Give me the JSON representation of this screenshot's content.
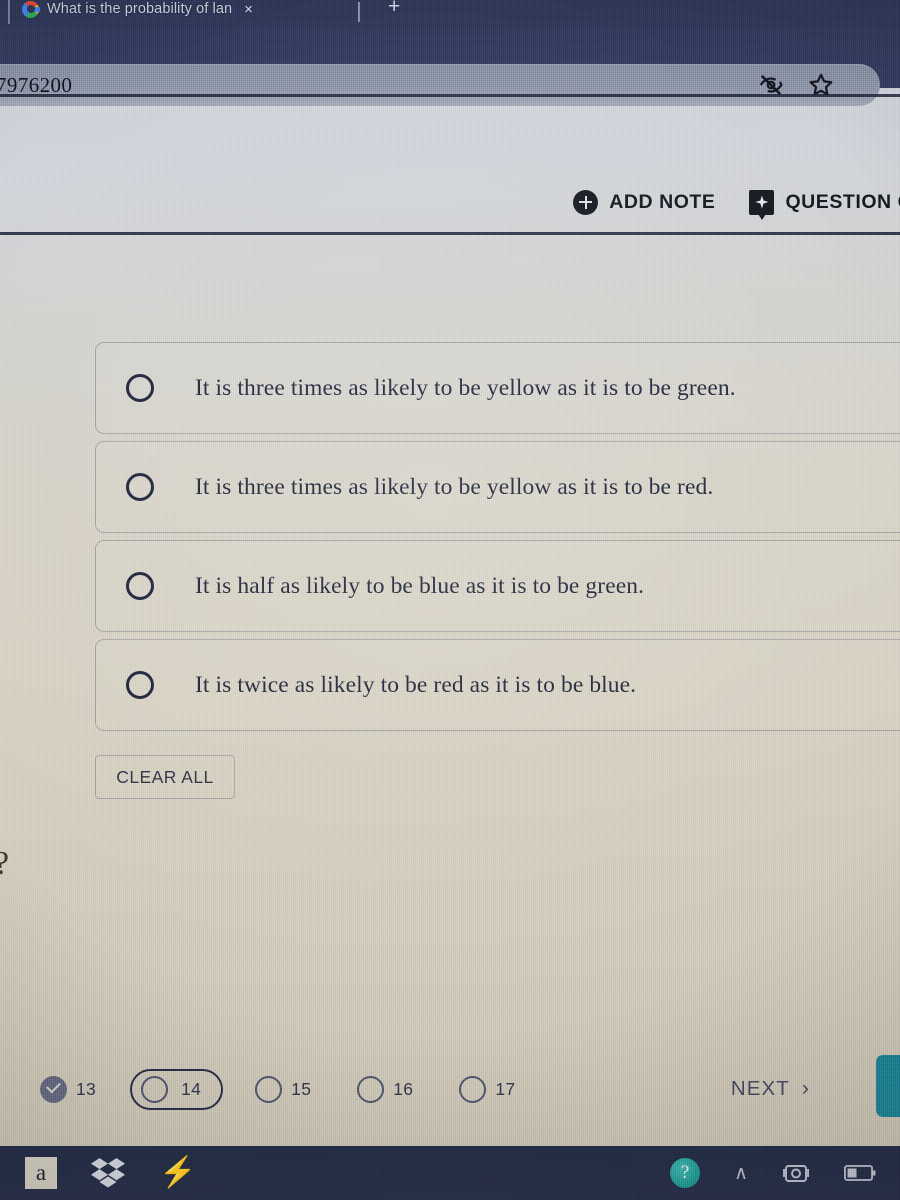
{
  "browser": {
    "tab_title": "What is the probability of lan",
    "tab_close_label": "×",
    "new_tab_label": "+",
    "favicon_name": "google-favicon",
    "url_text": "7976200",
    "omnibox_icons": [
      "eye-off-icon",
      "bookmark-star-icon"
    ]
  },
  "header": {
    "add_note_label": "ADD NOTE",
    "question_guide_label": "QUESTION GU",
    "add_note_icon": "plus-circle-icon",
    "question_guide_icon": "guide-bookmark-icon"
  },
  "question": {
    "options": [
      {
        "label": "It is three times as likely to be yellow as it is to be green.",
        "selected": false
      },
      {
        "label": "It is three times as likely to be yellow as it is to be red.",
        "selected": false
      },
      {
        "label": "It is half as likely to be blue as it is to be green.",
        "selected": false
      },
      {
        "label": "It is twice as likely to be red as it is to be blue.",
        "selected": false
      }
    ],
    "clear_all_label": "CLEAR ALL"
  },
  "overlay": {
    "help_glyph": "?"
  },
  "question_nav": {
    "items": [
      {
        "number": "13",
        "state": "done"
      },
      {
        "number": "14",
        "state": "current"
      },
      {
        "number": "15",
        "state": "unanswered"
      },
      {
        "number": "16",
        "state": "unanswered"
      },
      {
        "number": "17",
        "state": "unanswered"
      }
    ],
    "next_label": "NEXT",
    "next_chevron": "›"
  },
  "taskbar": {
    "left_icons": [
      "acrobat-a-icon",
      "dropbox-icon",
      "bolt-icon"
    ],
    "right_icons": [
      "help-globe-icon",
      "show-hidden-chevron-icon",
      "camera-icon",
      "battery-icon"
    ],
    "acrobat_letter": "a",
    "bolt_glyph": "⚡",
    "help_glyph": "?",
    "chevron_glyph": "∧"
  },
  "colors": {
    "chrome_dark": "#2e3554",
    "omnibox": "#838c9f",
    "page_top": "#c7ccd6",
    "page_bottom": "#c3bcab",
    "ink": "#1d2235",
    "side_tab_teal": "#1d7a8c"
  }
}
